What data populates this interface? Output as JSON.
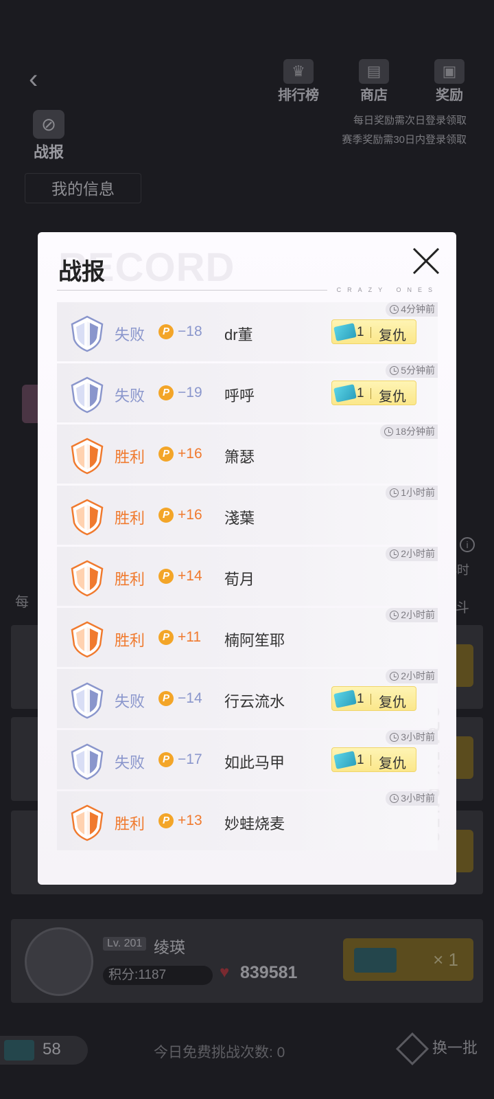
{
  "background": {
    "battle_report_label": "战报",
    "nav": [
      {
        "label": "排行榜",
        "icon": "trophy-icon"
      },
      {
        "label": "商店",
        "icon": "shop-icon"
      },
      {
        "label": "奖励",
        "icon": "gift-icon"
      }
    ],
    "reward_notes": [
      "每日奖励需次日登录领取",
      "赛季奖励需30日内登录领取"
    ],
    "my_info_title": "我的信息",
    "daily_label": "每",
    "hours_label": "小时",
    "battle_label": "战斗",
    "opponent_card": {
      "level": "Lv. 201",
      "name": "绫瑛",
      "score": "积分:1187",
      "likes": "839581",
      "ticket_count": "× 1"
    },
    "footer": {
      "ticket_count": "58",
      "free_challenges": "今日免费挑战次数: 0",
      "refresh_label": "换一批"
    }
  },
  "modal": {
    "title": "战报",
    "watermark": "RECORD",
    "tagline": "CRAZY ONES",
    "side_text": "CRAZY ONES",
    "revenge_label": "复仇",
    "records": [
      {
        "result": "失败",
        "type": "lose",
        "delta": "−18",
        "opponent": "dr董",
        "time": "4分钟前",
        "revenge": true,
        "cost": "1"
      },
      {
        "result": "失败",
        "type": "lose",
        "delta": "−19",
        "opponent": "呼呼",
        "time": "5分钟前",
        "revenge": true,
        "cost": "1"
      },
      {
        "result": "胜利",
        "type": "win",
        "delta": "+16",
        "opponent": "箫瑟",
        "time": "18分钟前",
        "revenge": false
      },
      {
        "result": "胜利",
        "type": "win",
        "delta": "+16",
        "opponent": "淺葉",
        "time": "1小时前",
        "revenge": false
      },
      {
        "result": "胜利",
        "type": "win",
        "delta": "+14",
        "opponent": "荀月",
        "time": "2小时前",
        "revenge": false
      },
      {
        "result": "胜利",
        "type": "win",
        "delta": "+11",
        "opponent": "楠阿笙耶",
        "time": "2小时前",
        "revenge": false
      },
      {
        "result": "失败",
        "type": "lose",
        "delta": "−14",
        "opponent": "行云流水",
        "time": "2小时前",
        "revenge": true,
        "cost": "1"
      },
      {
        "result": "失败",
        "type": "lose",
        "delta": "−17",
        "opponent": "如此马甲",
        "time": "3小时前",
        "revenge": true,
        "cost": "1"
      },
      {
        "result": "胜利",
        "type": "win",
        "delta": "+13",
        "opponent": "妙蛙烧麦",
        "time": "3小时前",
        "revenge": false
      }
    ]
  },
  "colors": {
    "lose": "#8a96cc",
    "win": "#f07a2e",
    "coin": "#f3a528",
    "revenge_button": "#fbe78b"
  }
}
